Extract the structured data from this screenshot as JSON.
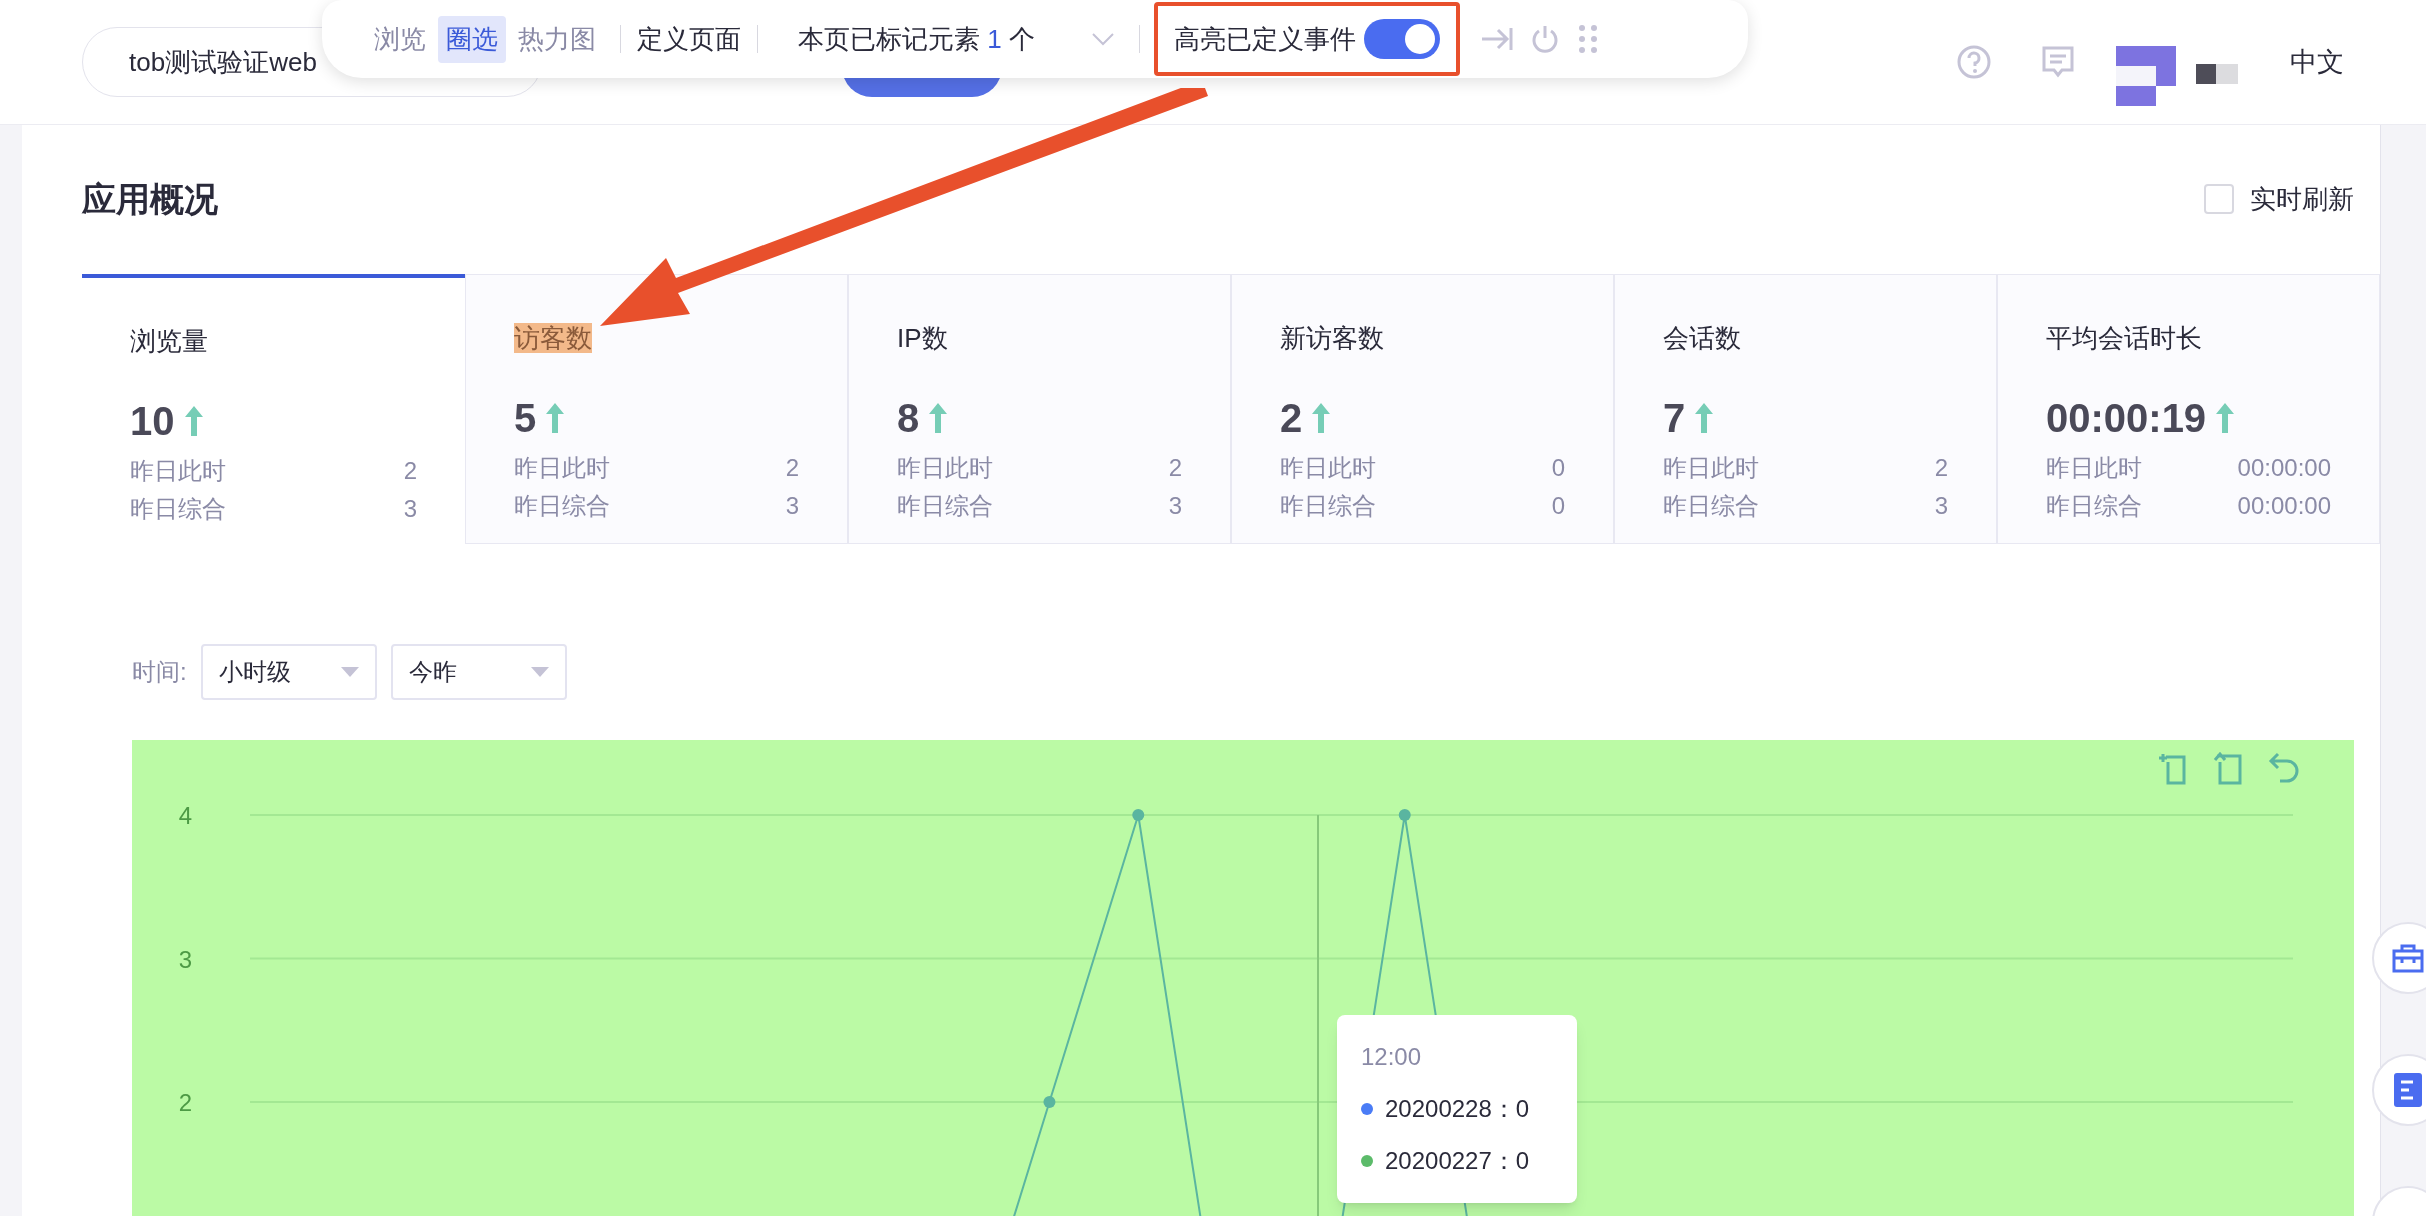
{
  "header": {
    "app_selector": "tob测试验证web",
    "language": "中文"
  },
  "toolbar": {
    "modes": [
      {
        "label": "浏览",
        "selected": false
      },
      {
        "label": "圈选",
        "selected": true
      },
      {
        "label": "热力图",
        "selected": false
      }
    ],
    "define_page": "定义页面",
    "marked": {
      "prefix": "本页已标记元素",
      "count": "1",
      "suffix": "个"
    },
    "highlight": {
      "label": "高亮已定义事件",
      "on": true
    }
  },
  "section": {
    "title": "应用概况",
    "realtime": {
      "label": "实时刷新",
      "checked": false
    }
  },
  "metrics": [
    {
      "label": "浏览量",
      "value": "10",
      "selected": true,
      "highlighted": false,
      "rows": [
        {
          "label": "昨日此时",
          "value": "2"
        },
        {
          "label": "昨日综合",
          "value": "3"
        }
      ]
    },
    {
      "label": "访客数",
      "value": "5",
      "selected": false,
      "highlighted": true,
      "rows": [
        {
          "label": "昨日此时",
          "value": "2"
        },
        {
          "label": "昨日综合",
          "value": "3"
        }
      ]
    },
    {
      "label": "IP数",
      "value": "8",
      "selected": false,
      "highlighted": false,
      "rows": [
        {
          "label": "昨日此时",
          "value": "2"
        },
        {
          "label": "昨日综合",
          "value": "3"
        }
      ]
    },
    {
      "label": "新访客数",
      "value": "2",
      "selected": false,
      "highlighted": false,
      "rows": [
        {
          "label": "昨日此时",
          "value": "0"
        },
        {
          "label": "昨日综合",
          "value": "0"
        }
      ]
    },
    {
      "label": "会话数",
      "value": "7",
      "selected": false,
      "highlighted": false,
      "rows": [
        {
          "label": "昨日此时",
          "value": "2"
        },
        {
          "label": "昨日综合",
          "value": "3"
        }
      ]
    },
    {
      "label": "平均会话时长",
      "value": "00:00:19",
      "selected": false,
      "highlighted": false,
      "rows": [
        {
          "label": "昨日此时",
          "value": "00:00:00"
        },
        {
          "label": "昨日综合",
          "value": "00:00:00"
        }
      ]
    }
  ],
  "filters": {
    "label": "时间:",
    "selects": [
      "小时级",
      "今昨"
    ]
  },
  "chart": {
    "tooltip": {
      "title": "12:00",
      "items": [
        {
          "label": "20200228：0",
          "color": "#4a7cf6"
        },
        {
          "label": "20200227：0",
          "color": "#5cbb6a"
        }
      ]
    },
    "y_axis_labels": [
      "4",
      "3",
      "2"
    ]
  }
}
